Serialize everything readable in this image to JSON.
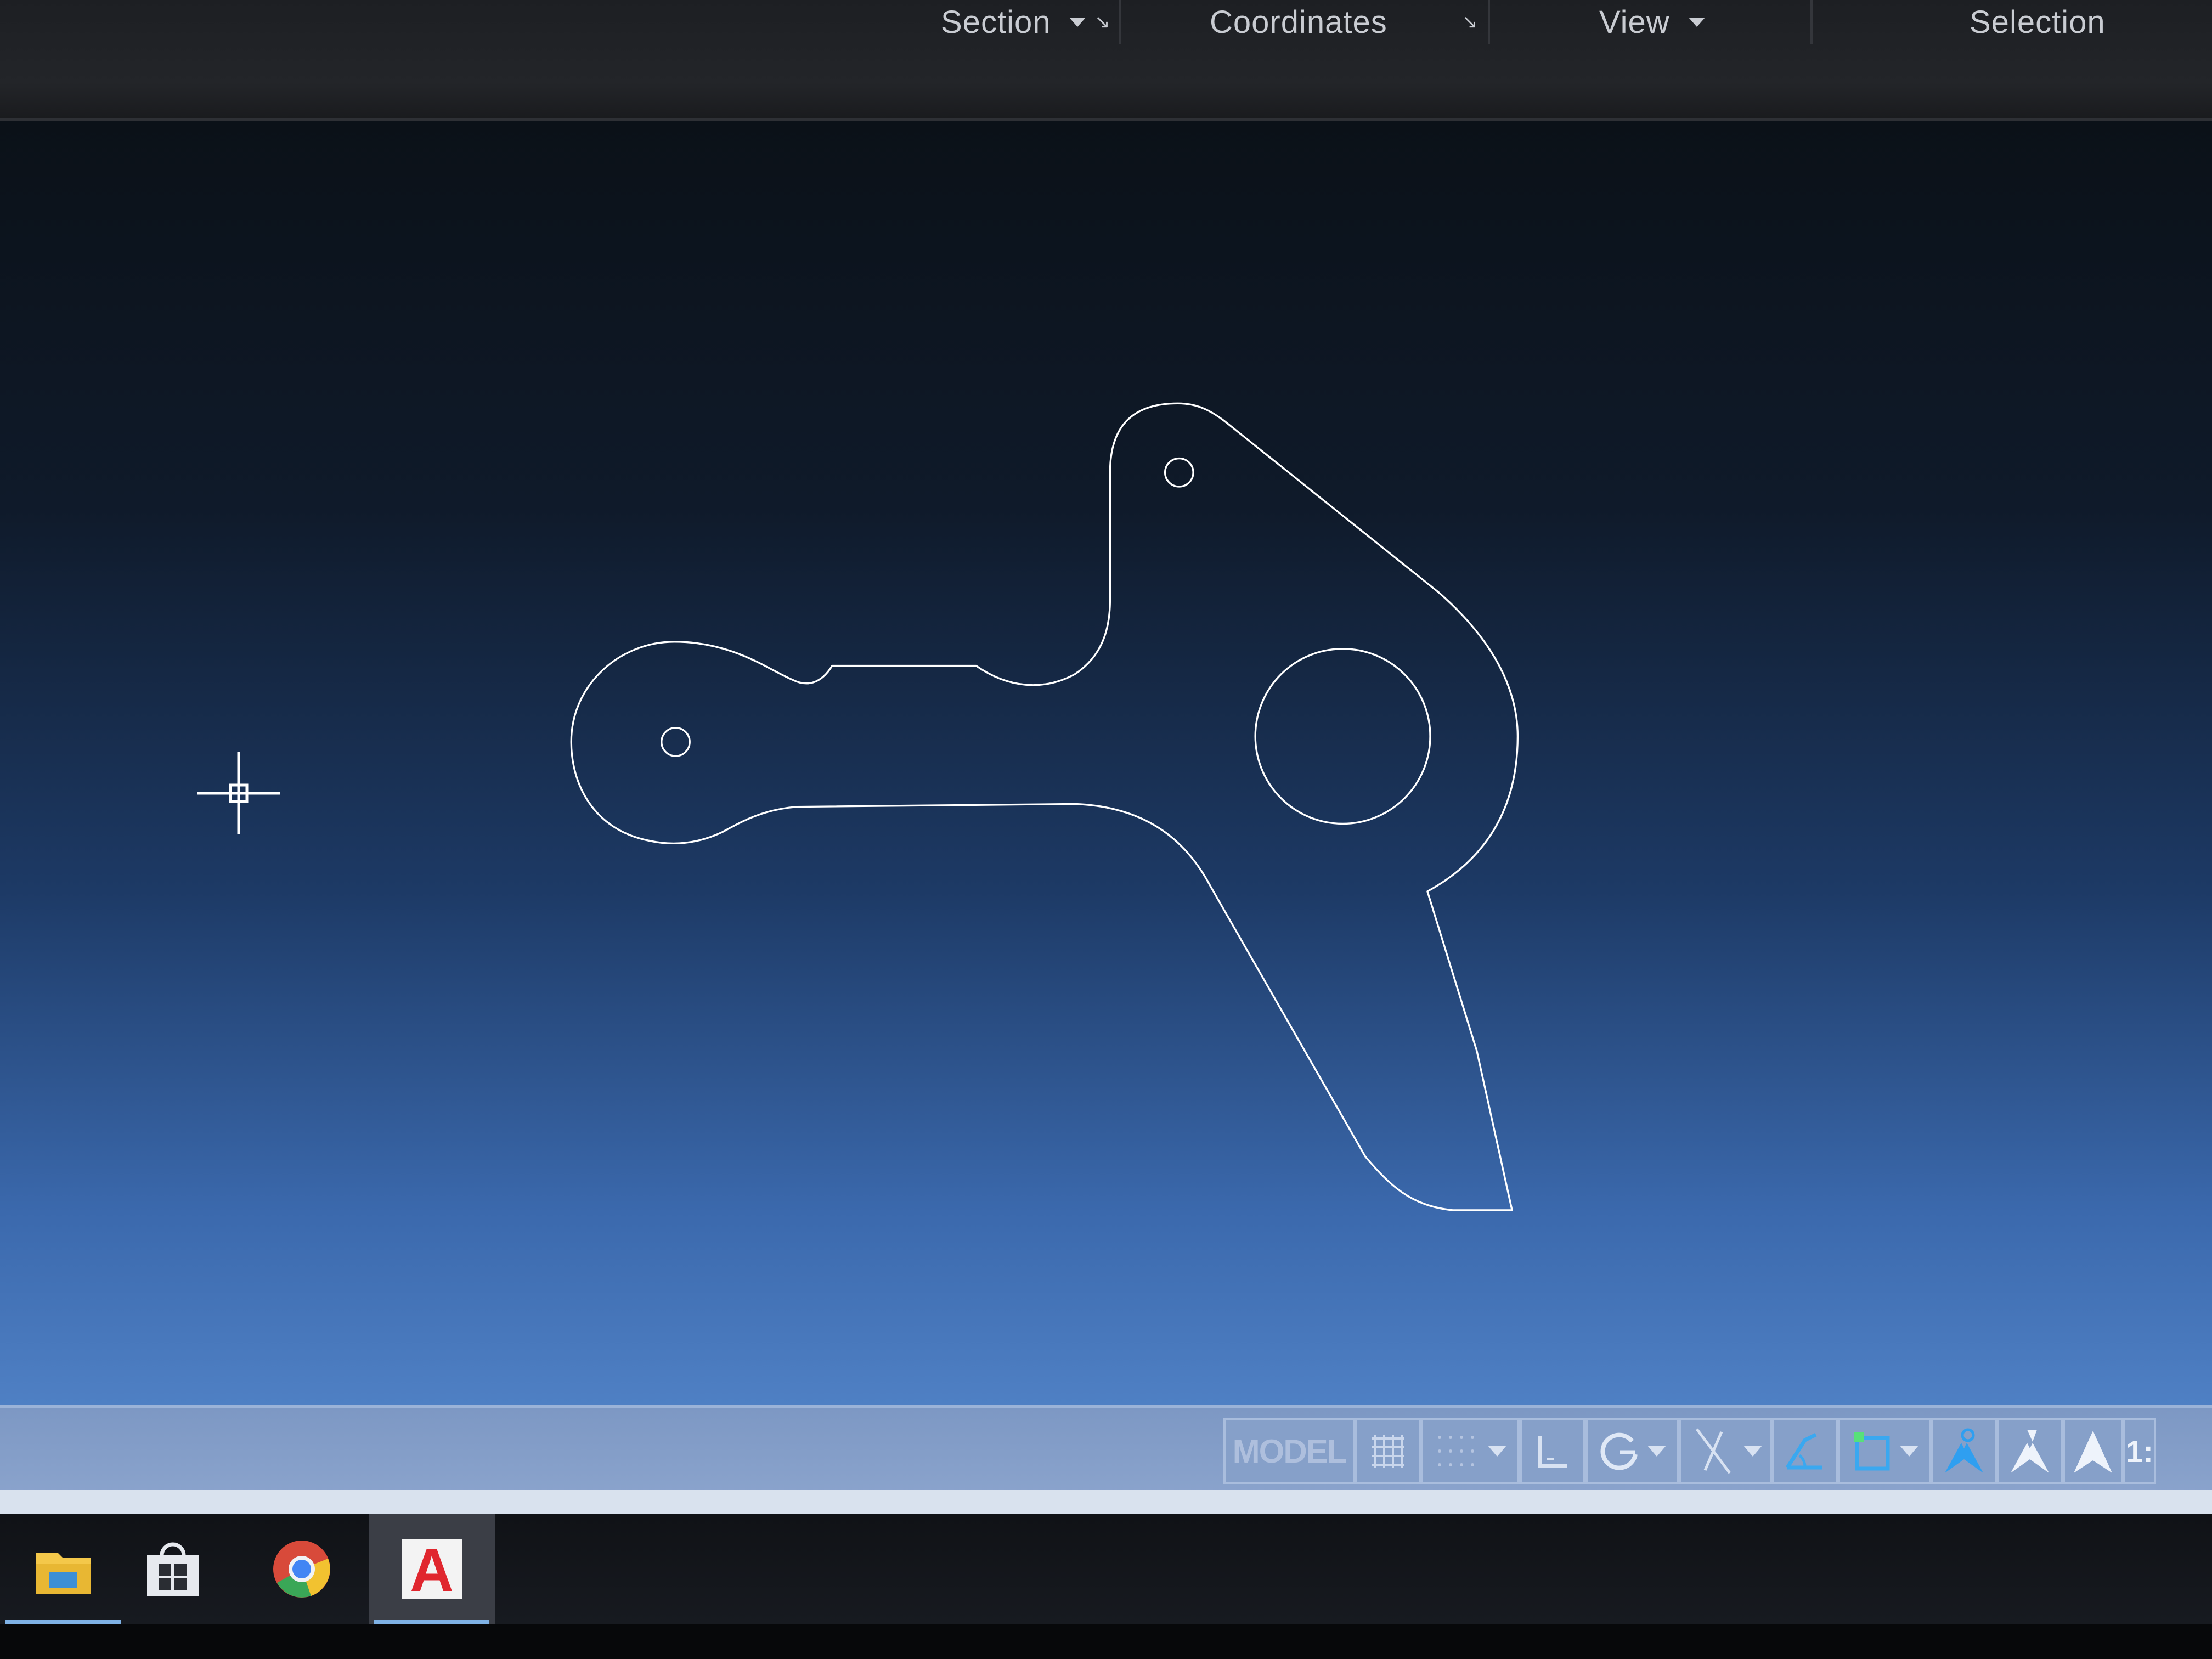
{
  "ribbon": {
    "panels": [
      {
        "label": "Section",
        "has_dropdown": true,
        "has_launcher": true
      },
      {
        "label": "Coordinates",
        "has_dropdown": false,
        "has_launcher": true
      },
      {
        "label": "View",
        "has_dropdown": true,
        "has_launcher": false
      },
      {
        "label": "Selection",
        "has_dropdown": false,
        "has_launcher": false
      }
    ],
    "launcher_glyph": "↘"
  },
  "canvas": {
    "background_top": "#0b1118",
    "background_bottom": "#4f80c4",
    "geometry_color": "#ffffff",
    "cursor_icon": "crosshair-pickbox-icon"
  },
  "statusbar": {
    "model_label": "MODEL",
    "scale_text": "1:",
    "tools": [
      "grid-icon",
      "snap-icon",
      "ortho-icon",
      "polar-tracking-icon",
      "isodraft-icon",
      "object-snap-tracking-icon",
      "object-snap-icon",
      "annotation-visibility-icon",
      "auto-scale-icon",
      "annotation-scale-icon"
    ]
  },
  "taskbar": {
    "apps": [
      {
        "name": "file-explorer-icon",
        "active": true
      },
      {
        "name": "store-icon",
        "active": false
      },
      {
        "name": "chrome-icon",
        "active": false
      },
      {
        "name": "autocad-icon",
        "active": true,
        "glyph": "A"
      }
    ]
  }
}
